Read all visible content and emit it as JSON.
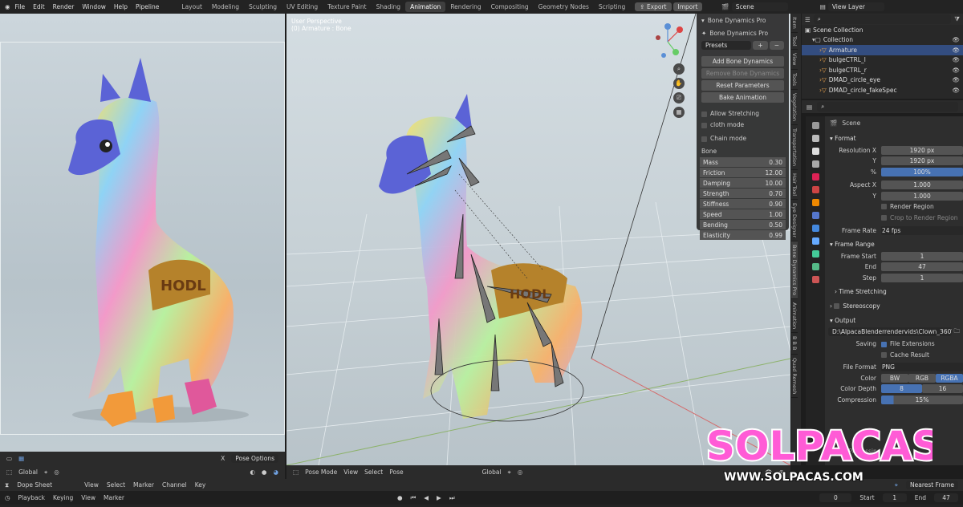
{
  "topbar": {
    "menu": [
      "File",
      "Edit",
      "Render",
      "Window",
      "Help",
      "Pipeline"
    ],
    "workspaces": [
      "Layout",
      "Modeling",
      "Sculpting",
      "UV Editing",
      "Texture Paint",
      "Shading",
      "Animation",
      "Rendering",
      "Compositing",
      "Geometry Nodes",
      "Scripting"
    ],
    "active_workspace": "Animation",
    "export_label": "Export",
    "import_label": "Import",
    "scene": "Scene",
    "view_layer": "View Layer"
  },
  "viewport": {
    "title": "User Perspective",
    "subtitle": "(0) Armature : Bone",
    "left_footer": {
      "x": "X",
      "pose_options": "Pose Options"
    },
    "right_footer": {
      "mode": "Pose Mode",
      "menu": [
        "View",
        "Select",
        "Pose"
      ],
      "orientation": "Global"
    },
    "left_header_orientation": "Global"
  },
  "npanel": {
    "header": "Bone Dynamics Pro",
    "subheader": "Bone Dynamics Pro",
    "presets": "Presets",
    "buttons": [
      "Add Bone Dynamics",
      "Remove Bone Dynamics",
      "Reset Parameters",
      "Bake Animation"
    ],
    "checks": [
      "Allow Stretching",
      "cloth mode",
      "Chain mode"
    ],
    "bone_section": "Bone",
    "params": [
      {
        "name": "Mass",
        "value": "0.30"
      },
      {
        "name": "Friction",
        "value": "12.00"
      },
      {
        "name": "Damping",
        "value": "10.00"
      },
      {
        "name": "Strength",
        "value": "0.70"
      },
      {
        "name": "Stiffness",
        "value": "0.90"
      },
      {
        "name": "Speed",
        "value": "1.00"
      },
      {
        "name": "Bending",
        "value": "0.50"
      },
      {
        "name": "Elasticity",
        "value": "0.99"
      }
    ]
  },
  "sidetabs": [
    "Item",
    "Tool",
    "View",
    "Tools",
    "Vegetation",
    "Transportation",
    "Hair Tool",
    "Eye Designer",
    "Bone Dynamics Pro",
    "Animation",
    "B B B",
    "Quad Remesh"
  ],
  "outliner": {
    "items": [
      {
        "label": "Scene Collection",
        "indent": 0
      },
      {
        "label": "Collection",
        "indent": 1
      },
      {
        "label": "Armature",
        "indent": 2,
        "selected": true
      },
      {
        "label": "bulgeCTRL_l",
        "indent": 2
      },
      {
        "label": "bulgeCTRL_r",
        "indent": 2
      },
      {
        "label": "DMAD_circle_eye",
        "indent": 2
      },
      {
        "label": "DMAD_circle_fakeSpec",
        "indent": 2
      }
    ]
  },
  "properties": {
    "scene_label": "Scene",
    "format": "Format",
    "resolution_x_label": "Resolution X",
    "resolution_x": "1920 px",
    "y_label": "Y",
    "resolution_y": "1920 px",
    "percent_label": "%",
    "percent": "100%",
    "aspect_x_label": "Aspect X",
    "aspect_x": "1.000",
    "aspect_y": "1.000",
    "render_region": "Render Region",
    "crop_region": "Crop to Render Region",
    "frame_rate_label": "Frame Rate",
    "frame_rate": "24 fps",
    "frame_range": "Frame Range",
    "frame_start_label": "Frame Start",
    "frame_start": "1",
    "end_label": "End",
    "end": "47",
    "step_label": "Step",
    "step": "1",
    "time_stretching": "Time Stretching",
    "stereoscopy": "Stereoscopy",
    "output": "Output",
    "output_path": "D:\\AlpacaBlenderrendervids\\Clown_360\\",
    "saving_label": "Saving",
    "file_extensions": "File Extensions",
    "cache_result": "Cache Result",
    "file_format_label": "File Format",
    "file_format": "PNG",
    "color_label": "Color",
    "color_options": [
      "BW",
      "RGB",
      "RGBA"
    ],
    "color_depth_label": "Color Depth",
    "depth_options": [
      "8",
      "16"
    ],
    "compression_label": "Compression",
    "compression": "15%",
    "post_processing": "Post Processing"
  },
  "timeline": {
    "editor": "Dope Sheet",
    "menu": [
      "View",
      "Select",
      "Marker",
      "Channel",
      "Key"
    ],
    "playback": "Playback",
    "keying": "Keying",
    "tl_menu": [
      "View",
      "Marker"
    ],
    "current_frame": "0",
    "start_label": "Start",
    "start": "1",
    "end_label": "End",
    "end": "47",
    "snap": "Nearest Frame"
  },
  "logo": {
    "title": "SOLPACAS",
    "url": "WWW.SOLPACAS.COM"
  },
  "sketch_text": "HODL"
}
